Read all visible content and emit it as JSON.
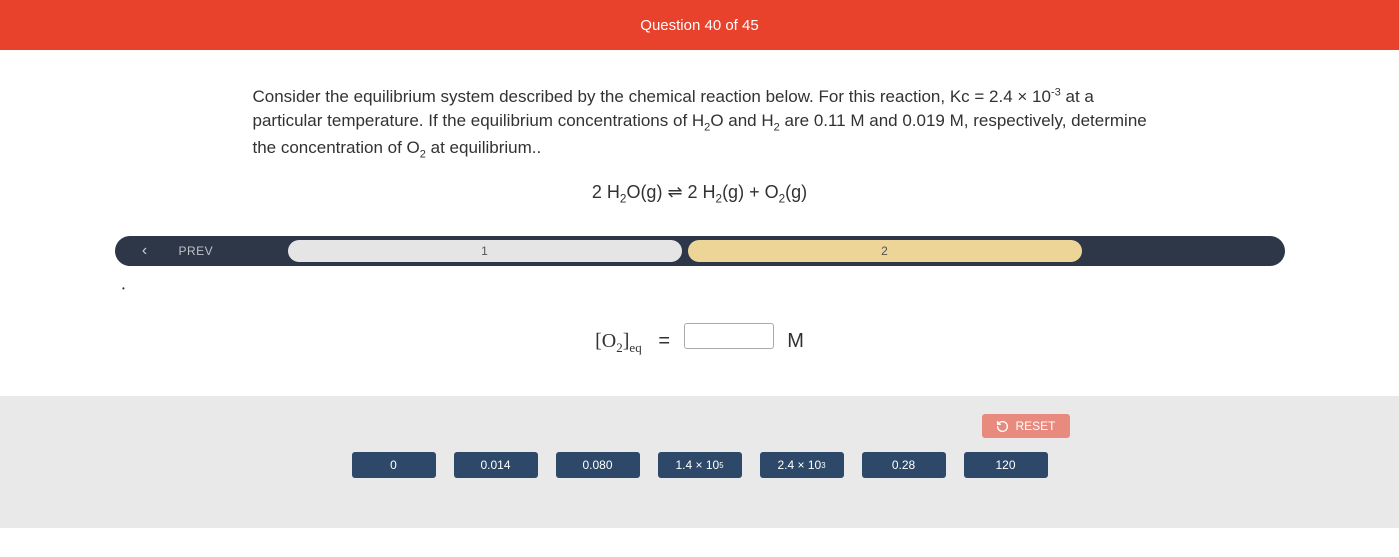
{
  "header": {
    "title": "Question 40 of 45"
  },
  "question": {
    "text_html": "Consider the equilibrium system described by the chemical reaction below. For this reaction, Kc = 2.4 × 10<sup>-3</sup> at a particular temperature. If the equilibrium concentrations of H<sub>2</sub>O and H<sub>2</sub> are 0.11 M and 0.019 M, respectively, determine the concentration of O<sub>2</sub> at equilibrium..",
    "equation_html": "2 H<sub>2</sub>O(g) ⇌ 2 H<sub>2</sub>(g) + O<sub>2</sub>(g)"
  },
  "nav": {
    "prev_label": "PREV",
    "steps": [
      {
        "label": "1",
        "state": "active"
      },
      {
        "label": "2",
        "state": "inactive"
      }
    ]
  },
  "input": {
    "label_prefix_html": "[O<sub>2</sub>]<sub>eq</sub>",
    "equals": "=",
    "unit": "M",
    "value": ""
  },
  "reset_label": "RESET",
  "choices": [
    {
      "label": "0"
    },
    {
      "label": "0.014"
    },
    {
      "label": "0.080"
    },
    {
      "label_html": "1.4 × 10<sup>5</sup>"
    },
    {
      "label_html": "2.4 × 10<sup>3</sup>"
    },
    {
      "label": "0.28"
    },
    {
      "label": "120"
    }
  ]
}
